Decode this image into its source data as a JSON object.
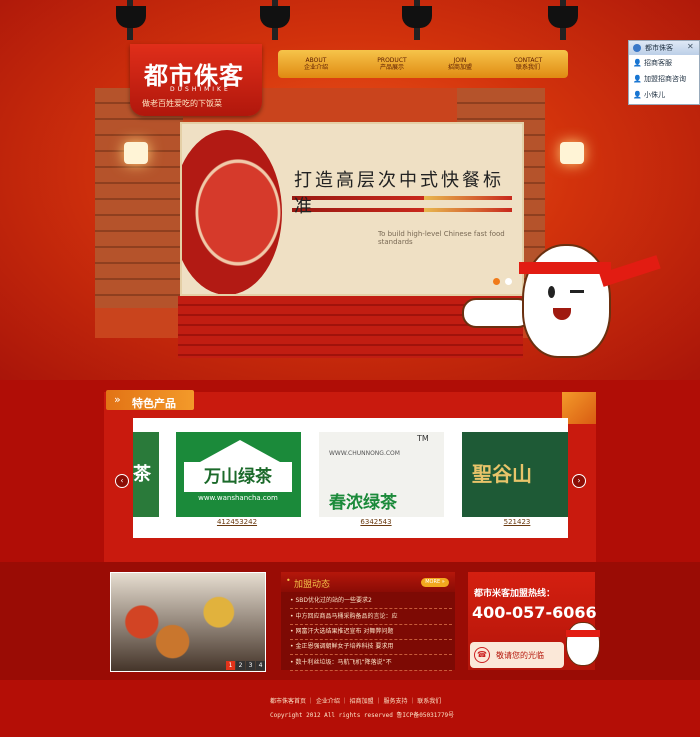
{
  "header": {
    "logo_cn": "都市侏客",
    "logo_en": "DUSHIMIKE",
    "tagline": "做老百姓爱吃的下饭菜",
    "nav": [
      {
        "en": "ABOUT",
        "cn": "企业介绍"
      },
      {
        "en": "PRODUCT",
        "cn": "产品展示"
      },
      {
        "en": "JOIN",
        "cn": "招商加盟"
      },
      {
        "en": "CONTACT",
        "cn": "联系我们"
      }
    ]
  },
  "banner": {
    "slogan": "打造高层次中式快餐标准",
    "slogan_en": "To build high-level Chinese fast food standards"
  },
  "chat": {
    "title": "都市侏客",
    "rows": [
      "招商客服",
      "加盟招商咨询",
      "小侏儿"
    ]
  },
  "products": {
    "title": "特色产品",
    "prev": "‹",
    "next": "›",
    "items": [
      {
        "brand": "茶",
        "label": ""
      },
      {
        "brand": "万山绿茶",
        "sub": "www.wanshancha.com",
        "label": "412453242"
      },
      {
        "brand": "春浓绿茶",
        "sub": "WWW.CHUNNONG.COM",
        "label": "6342543"
      },
      {
        "brand": "聖谷山",
        "label": "521423"
      }
    ]
  },
  "news": {
    "title": "加盟动态",
    "more": "MORE »",
    "items": [
      "SBD优化过的站的一些要求2",
      "中方回应商品马桶采购备品的言论：应",
      "网富汗大选结果推迟宣布 对舞弊问题",
      "金正恩强调朝鲜女子培养科技 要求用",
      "数十利丝垃圾：马航飞机“降落说”不"
    ],
    "pages": [
      "1",
      "2",
      "3",
      "4"
    ]
  },
  "hotline": {
    "title": "都市米客加盟热线：",
    "number": "400-057-6066",
    "welcome": "敬请您的光临"
  },
  "footer": {
    "links": "都市侏客首页 ｜ 企业介绍 ｜ 招商加盟 ｜ 服务支持 ｜ 联系我们",
    "copyright": "Copyright 2012 All rights reserved 鲁ICP备05031779号"
  }
}
